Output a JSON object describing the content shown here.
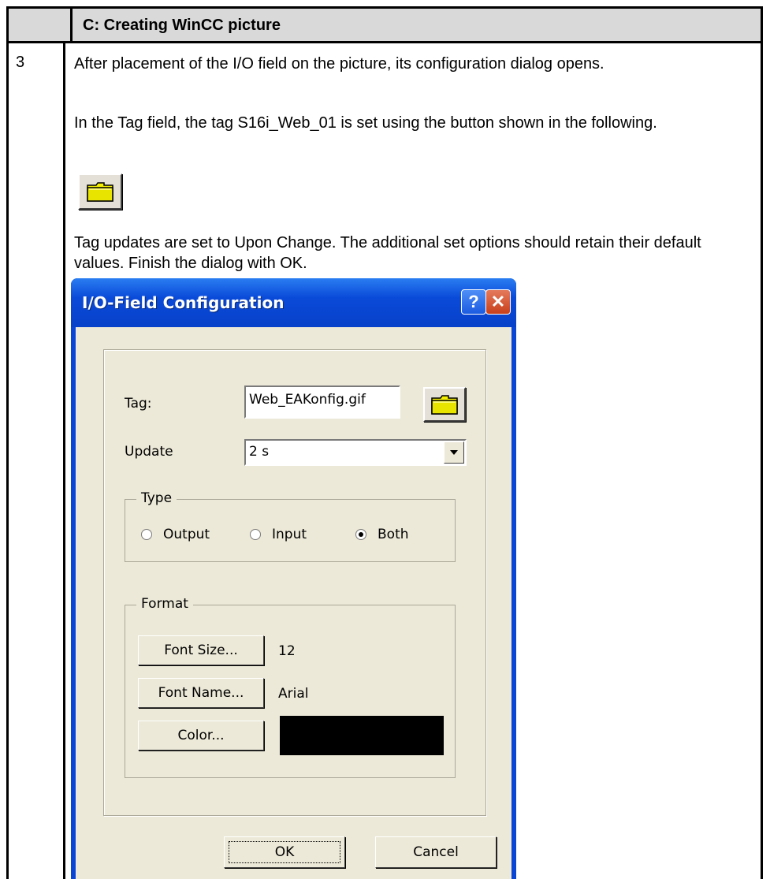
{
  "section": {
    "title": "C: Creating WinCC picture",
    "step_number": "3",
    "paragraphs": [
      "After placement of the I/O field on the picture, its configuration dialog opens.",
      "In the Tag field, the tag S16i_Web_01 is set using the button shown in the following.",
      "Tag updates are set to Upon Change. The additional set options should retain their default values. Finish the dialog with OK."
    ]
  },
  "dialog": {
    "title": "I/O-Field Configuration",
    "help_label": "?",
    "close_label": "✕",
    "tag_label": "Tag:",
    "tag_value": "Web_EAKonfig.gif",
    "update_label": "Update",
    "update_value": "2 s",
    "type_group_title": "Type",
    "type_options": [
      "Output",
      "Input",
      "Both"
    ],
    "type_selected": "Both",
    "format_group_title": "Format",
    "font_size_button": "Font Size...",
    "font_size_value": "12",
    "font_name_button": "Font Name...",
    "font_name_value": "Arial",
    "color_button": "Color...",
    "color_value": "#000000",
    "ok_label": "OK",
    "cancel_label": "Cancel"
  },
  "icons": {
    "browse": "folder-icon",
    "dropdown": "chevron-down-icon"
  }
}
